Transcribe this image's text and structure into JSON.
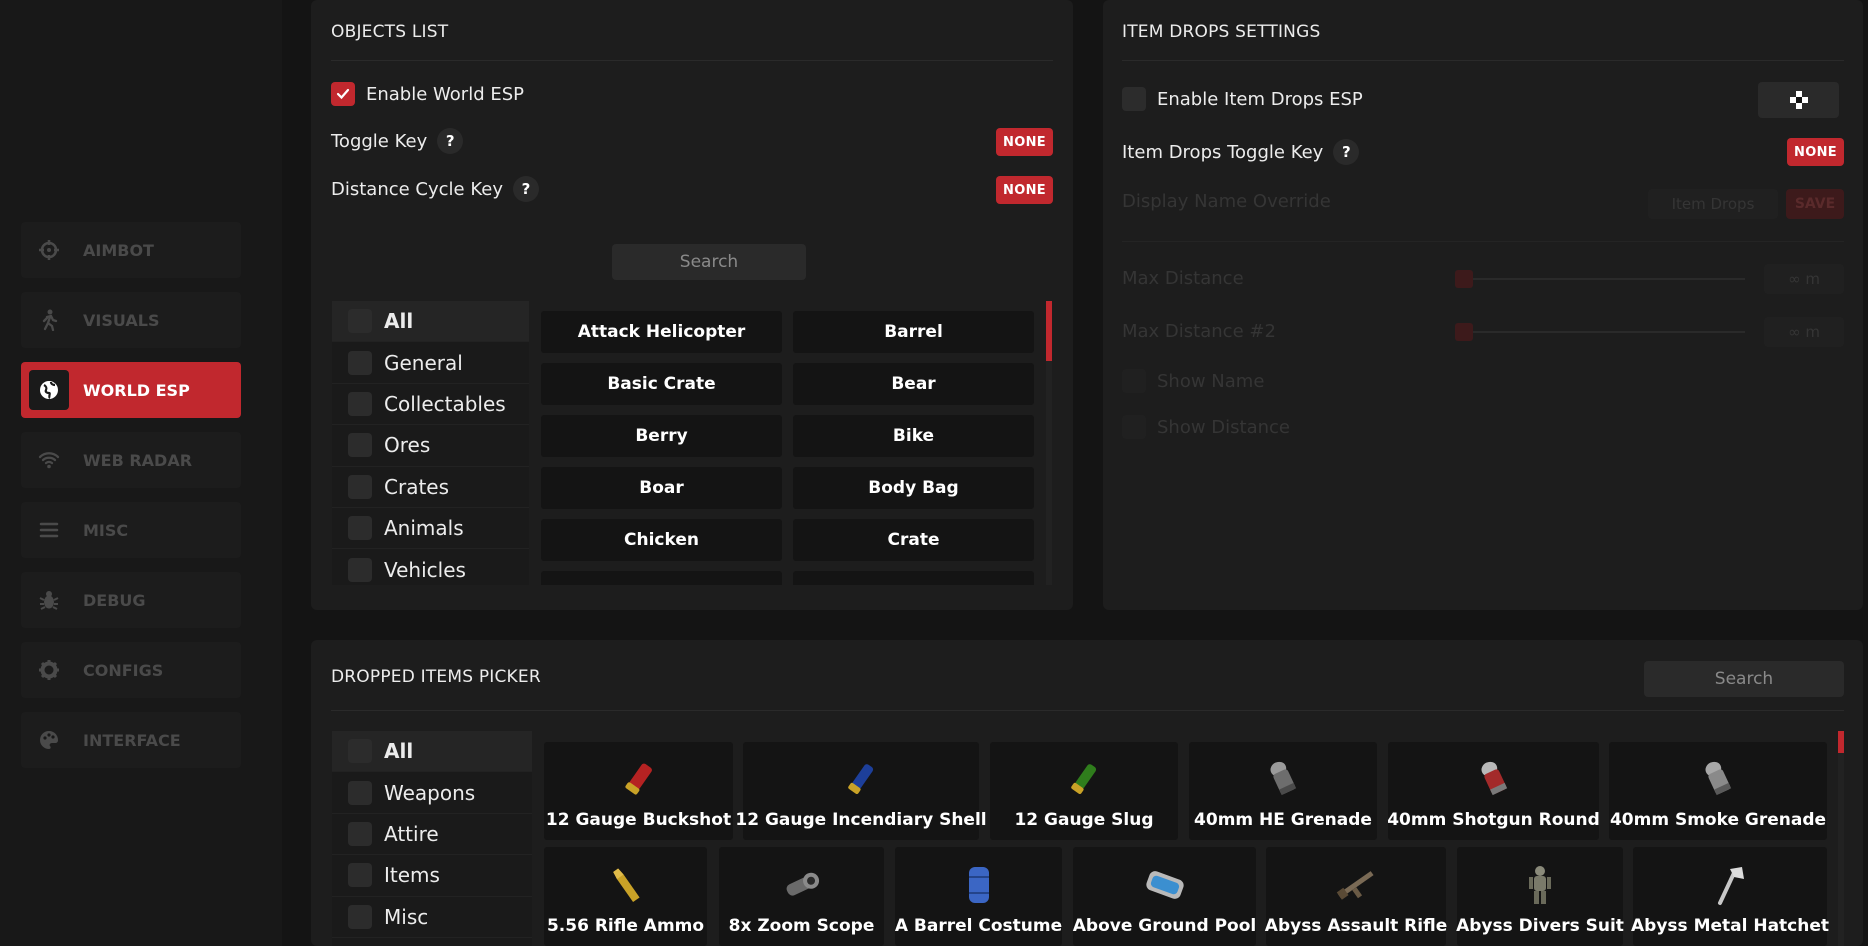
{
  "sidebar": {
    "items": [
      {
        "label": "AIMBOT",
        "icon": "crosshair-icon"
      },
      {
        "label": "VISUALS",
        "icon": "person-walking-icon"
      },
      {
        "label": "WORLD ESP",
        "icon": "globe-icon"
      },
      {
        "label": "WEB RADAR",
        "icon": "wifi-icon"
      },
      {
        "label": "MISC",
        "icon": "menu-icon"
      },
      {
        "label": "DEBUG",
        "icon": "bug-icon"
      },
      {
        "label": "CONFIGS",
        "icon": "gear-icon"
      },
      {
        "label": "INTERFACE",
        "icon": "palette-icon"
      }
    ],
    "active_label": "WORLD ESP"
  },
  "objects_list": {
    "title": "OBJECTS LIST",
    "enable_label": "Enable World ESP",
    "enable_checked": true,
    "toggle_key_label": "Toggle Key",
    "toggle_key_value": "NONE",
    "distance_cycle_label": "Distance Cycle Key",
    "distance_cycle_value": "NONE",
    "help_glyph": "?",
    "search_placeholder": "Search",
    "categories": [
      "All",
      "General",
      "Collectables",
      "Ores",
      "Crates",
      "Animals",
      "Vehicles"
    ],
    "objects": [
      "Attack Helicopter",
      "Barrel",
      "Basic Crate",
      "Bear",
      "Berry",
      "Bike",
      "Boar",
      "Body Bag",
      "Chicken",
      "Crate"
    ]
  },
  "item_drops": {
    "title": "ITEM DROPS SETTINGS",
    "enable_label": "Enable Item Drops ESP",
    "toggle_label": "Item Drops Toggle Key",
    "toggle_value": "NONE",
    "display_name_label": "Display Name Override",
    "display_name_value": "Item Drops",
    "save_label": "SAVE",
    "max_distance_label": "Max Distance",
    "max_distance_value": "∞ m",
    "max_distance2_label": "Max Distance #2",
    "max_distance2_value": "∞ m",
    "show_name_label": "Show Name",
    "show_distance_label": "Show Distance"
  },
  "dropped_items": {
    "title": "DROPPED ITEMS PICKER",
    "search_placeholder": "Search",
    "categories": [
      "All",
      "Weapons",
      "Attire",
      "Items",
      "Misc"
    ],
    "row1": [
      "12 Gauge Buckshot",
      "12 Gauge Incendiary Shell",
      "12 Gauge Slug",
      "40mm HE Grenade",
      "40mm Shotgun Round",
      "40mm Smoke Grenade"
    ],
    "row2": [
      "5.56 Rifle Ammo",
      "8x Zoom Scope",
      "A Barrel Costume",
      "Above Ground Pool",
      "Abyss Assault Rifle",
      "Abyss Divers Suit",
      "Abyss Metal Hatchet"
    ]
  },
  "colors": {
    "accent": "#c1282e",
    "background": "#141414",
    "panel": "#1d1d1d"
  }
}
